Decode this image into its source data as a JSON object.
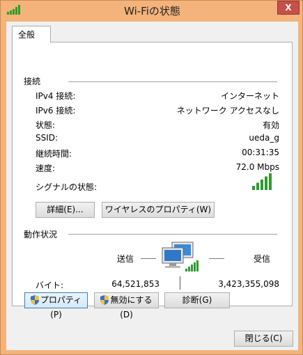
{
  "window": {
    "title": "Wi-Fiの状態",
    "close_glyph": "X"
  },
  "tabs": [
    {
      "label": "全般",
      "selected": true
    }
  ],
  "connection": {
    "section_title": "接続",
    "rows": [
      {
        "label": "IPv4 接続:",
        "value": "インターネット"
      },
      {
        "label": "IPv6 接続:",
        "value": "ネットワーク アクセスなし"
      },
      {
        "label": "状態:",
        "value": "有効"
      },
      {
        "label": "SSID:",
        "value": "ueda_g"
      },
      {
        "label": "継続時間:",
        "value": "00:31:35"
      },
      {
        "label": "速度:",
        "value": "72.0 Mbps"
      }
    ],
    "signal_label": "シグナルの状態:",
    "signal_bars": 5,
    "signal_bars_max": 5,
    "details_button": "詳細(E)...",
    "wireless_props_button": "ワイヤレスのプロパティ(W)"
  },
  "activity": {
    "section_title": "動作状況",
    "sent_label": "送信",
    "received_label": "受信",
    "bytes_label": "バイト:",
    "bytes_sent": "64,521,853",
    "bytes_received": "3,423,355,098"
  },
  "actions": {
    "properties_button": "プロパティ(P)",
    "disable_button": "無効にする(D)",
    "diagnose_button": "診断(G)"
  },
  "footer": {
    "close_button": "閉じる(C)"
  },
  "colors": {
    "frame": "#f4b37a",
    "signal": "#2e9b2e",
    "focus_border": "#3c7fb1",
    "close": "#c7504a"
  }
}
